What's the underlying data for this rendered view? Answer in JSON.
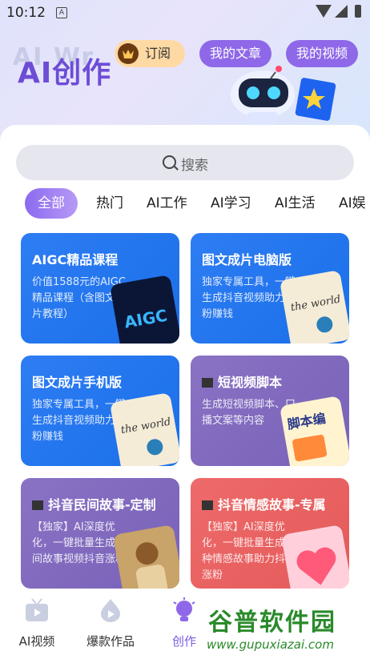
{
  "status_bar": {
    "time": "10:12",
    "sim_label": "A"
  },
  "header": {
    "brand": "AI创作",
    "brand_ghost": "AI Wr",
    "subscribe_label": "订阅",
    "my_articles_label": "我的文章",
    "my_videos_label": "我的视频"
  },
  "search": {
    "placeholder": "搜索"
  },
  "tabs": [
    "全部",
    "热门",
    "AI工作",
    "AI学习",
    "AI生活",
    "AI娱"
  ],
  "cards": [
    {
      "title": "AIGC精品课程",
      "desc": "价值1588元的AIGC精品课程（含图文成片教程）",
      "thumb_text": "AIGC"
    },
    {
      "title": "图文成片电脑版",
      "desc": "独家专属工具，一键生成抖音视频助力涨粉赚钱",
      "thumb_text": "the world"
    },
    {
      "title": "图文成片手机版",
      "desc": "独家专属工具，一键生成抖音视频助力涨粉赚钱",
      "thumb_text": "the world"
    },
    {
      "title": "短视频脚本",
      "desc": "生成短视频脚本、口播文案等内容",
      "thumb_text": "脚本编"
    },
    {
      "title": "抖音民间故事-定制",
      "desc": "【独家】AI深度优化，一键批量生成民间故事视频抖音涨粉"
    },
    {
      "title": "抖音情感故事-专属",
      "desc": "【独家】AI深度优化，一键批量生成多种情感故事助力抖音涨粉"
    }
  ],
  "bottom_nav": [
    {
      "label": "AI视频",
      "icon": "tv-icon"
    },
    {
      "label": "爆款作品",
      "icon": "flame-play-icon"
    },
    {
      "label": "创作",
      "icon": "bulb-icon",
      "active": true
    }
  ],
  "watermark": {
    "text": "谷普软件园",
    "url": "www.gupuxiazai.com"
  },
  "colors": {
    "accent": "#7a5ae0",
    "blue_card": "#1a6fe8",
    "purple_card": "#7862b8",
    "red_card": "#e45a5a"
  }
}
